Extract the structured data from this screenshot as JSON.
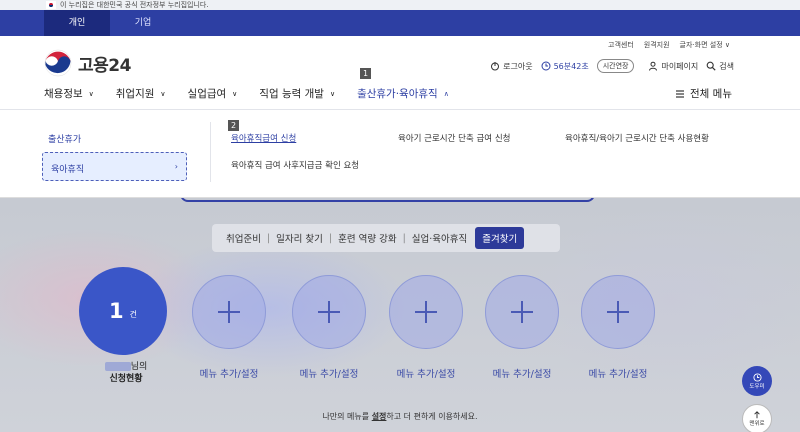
{
  "gov_banner": {
    "text": "이 누리집은 대한민국 공식 전자정부 누리집입니다."
  },
  "tabs": [
    {
      "label": "개인",
      "active": true
    },
    {
      "label": "기업",
      "active": false
    }
  ],
  "util_links": [
    "고객센터",
    "원격지원",
    "글자·화면 설정 ∨"
  ],
  "logo": {
    "text": "고용24"
  },
  "right_util": {
    "logout": "로그아웃",
    "timer": "56분42초",
    "extend": "시간연장",
    "mypage": "마이페이지",
    "search": "검색"
  },
  "main_nav": [
    {
      "label": "채용정보",
      "active": false
    },
    {
      "label": "취업지원",
      "active": false
    },
    {
      "label": "실업급여",
      "active": false
    },
    {
      "label": "직업 능력 개발",
      "active": false
    },
    {
      "label": "출산휴가·육아휴직",
      "active": true
    }
  ],
  "nav_badge": "1",
  "all_menu": "전체 메뉴",
  "dropdown": {
    "side": [
      "출산휴가",
      "육아휴직"
    ],
    "badge": "2",
    "subs": [
      "육아휴직급여 신청",
      "육아기 근로시간 단축 급여 신청",
      "육아휴직/육아기 근로시간 단축 사용현황",
      "육아휴직 급여 사후지급금 확인 요청"
    ]
  },
  "quick": {
    "items": [
      "취업준비",
      "일자리 찾기",
      "훈련 역량 강화",
      "실업·육아휴직"
    ],
    "fav": "즐겨찾기"
  },
  "status": {
    "count": "1",
    "unit": "건",
    "suffix": "님의",
    "title": "신청현황"
  },
  "add_menu_label": "메뉴 추가/설정",
  "bottom_note": {
    "pre": "나만의 메뉴를 ",
    "link": "설정",
    "post": "하고 더 편하게 이용하세요."
  },
  "float": {
    "help": "도우미",
    "top": "맨위로"
  }
}
